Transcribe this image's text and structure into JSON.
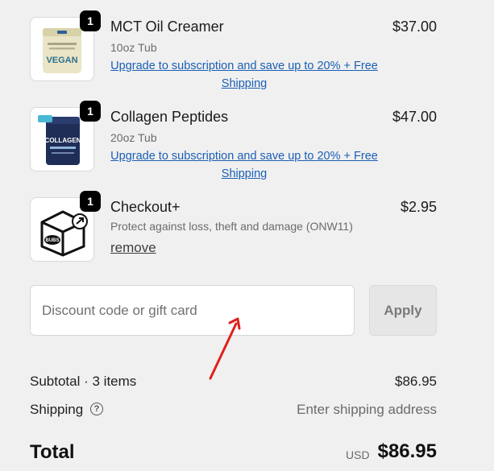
{
  "line_items": [
    {
      "quantity": "1",
      "name": "MCT Oil Creamer",
      "variant": "10oz Tub",
      "price": "$37.00",
      "upsell": "Upgrade to subscription and save up to 20% + Free Shipping",
      "image_label": "VEGAN"
    },
    {
      "quantity": "1",
      "name": "Collagen Peptides",
      "variant": "20oz Tub",
      "price": "$47.00",
      "upsell": "Upgrade to subscription and save up to 20% + Free Shipping",
      "image_label": "COLLAGEN"
    },
    {
      "quantity": "1",
      "name": "Checkout+",
      "variant": "Protect against loss, theft and damage (ONW11)",
      "price": "$2.95",
      "remove_label": "remove",
      "image_label": "BUBS"
    }
  ],
  "discount": {
    "placeholder": "Discount code or gift card",
    "apply_label": "Apply"
  },
  "summary": {
    "subtotal_label": "Subtotal · 3 items",
    "subtotal_value": "$86.95",
    "shipping_label": "Shipping",
    "shipping_value": "Enter shipping address",
    "help_glyph": "?",
    "total_label": "Total",
    "total_currency": "USD",
    "total_value": "$86.95"
  },
  "colors": {
    "background": "#f0f0f0",
    "link": "#1a5fb4",
    "annotation_arrow": "#e0201b"
  },
  "icons": [
    "question-circle-icon",
    "package-icon",
    "annotation-arrow"
  ]
}
